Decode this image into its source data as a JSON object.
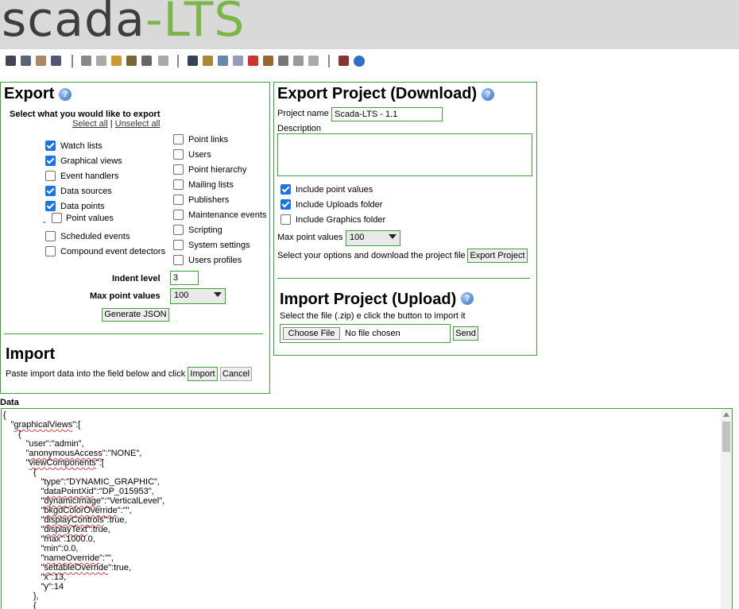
{
  "logo": {
    "part1": "scada",
    "sep": "-",
    "part2": "LTS"
  },
  "toolbar": {
    "icons": [
      "monitor-icon",
      "image-icon",
      "pencil-icon",
      "book-icon",
      "gear-icon",
      "database-icon",
      "clock-icon",
      "bug-icon",
      "hat-icon",
      "eraser-icon",
      "user-icon",
      "users-icon",
      "folders-icon",
      "documents-icon",
      "antenna-icon",
      "hammer-icon",
      "table-icon",
      "code-icon",
      "page-icon",
      "logout-icon",
      "help-icon"
    ]
  },
  "export": {
    "title": "Export",
    "select_label": "Select what you would like to export",
    "select_all": "Select all",
    "sep": " | ",
    "unselect_all": "Unselect all",
    "left_items": [
      {
        "label": "Watch lists",
        "checked": true
      },
      {
        "label": "Graphical views",
        "checked": true
      },
      {
        "label": "Event handlers",
        "checked": false
      },
      {
        "label": "Data sources",
        "checked": true
      },
      {
        "label": "Data points",
        "checked": true
      },
      {
        "label": "Point values",
        "checked": false,
        "prefix": "-"
      },
      {
        "label": "Scheduled events",
        "checked": false
      },
      {
        "label": "Compound event detectors",
        "checked": false
      }
    ],
    "right_items": [
      {
        "label": "Point links",
        "checked": false
      },
      {
        "label": "Users",
        "checked": false
      },
      {
        "label": "Point hierarchy",
        "checked": false
      },
      {
        "label": "Mailing lists",
        "checked": false
      },
      {
        "label": "Publishers",
        "checked": false
      },
      {
        "label": "Maintenance events",
        "checked": false
      },
      {
        "label": "Scripting",
        "checked": false
      },
      {
        "label": "System settings",
        "checked": false
      },
      {
        "label": "Users profiles",
        "checked": false
      }
    ],
    "indent_label": "Indent level",
    "indent_value": "3",
    "max_label": "Max point values",
    "max_value": "100",
    "generate_label": "Generate JSON"
  },
  "import": {
    "title": "Import",
    "desc": "Paste import data into the field below and click",
    "import_label": "Import",
    "cancel_label": "Cancel"
  },
  "project_export": {
    "title": "Export Project (Download)",
    "name_label": "Project name",
    "name_value": "Scada-LTS - 1.1",
    "desc_label": "Description",
    "options": [
      {
        "label": "Include point values",
        "checked": true
      },
      {
        "label": "Include Uploads folder",
        "checked": true
      },
      {
        "label": "Include Graphics folder",
        "checked": false
      }
    ],
    "max_label": "Max point values",
    "max_value": "100",
    "download_text": "Select your options and download the project file",
    "export_btn": "Export Project"
  },
  "project_import": {
    "title": "Import Project (Upload)",
    "desc": "Select the file (.zip) e click the button to import it",
    "choose_btn": "Choose File",
    "no_file": "No file chosen",
    "send_btn": "Send"
  },
  "data": {
    "label": "Data",
    "lines": [
      {
        "indent": 0,
        "pre": "{",
        "key": "",
        "post": ""
      },
      {
        "indent": 1,
        "pre": "\"",
        "key": "graphicalViews",
        "post": "\":["
      },
      {
        "indent": 2,
        "pre": "{",
        "key": "",
        "post": ""
      },
      {
        "indent": 3,
        "pre": "\"user\":\"admin\",",
        "key": "",
        "post": ""
      },
      {
        "indent": 3,
        "pre": "\"",
        "key": "anonymousAccess",
        "post": "\":\"NONE\","
      },
      {
        "indent": 3,
        "pre": "\"",
        "key": "viewComponents",
        "post": "\":["
      },
      {
        "indent": 4,
        "pre": "{",
        "key": "",
        "post": ""
      },
      {
        "indent": 5,
        "pre": "\"type\":\"DYNAMIC_GRAPHIC\",",
        "key": "",
        "post": ""
      },
      {
        "indent": 5,
        "pre": "\"",
        "key": "dataPointXid",
        "post": "\":\"DP_015953\","
      },
      {
        "indent": 5,
        "pre": "\"",
        "key": "dynamicImage",
        "post": "\":\"VerticalLevel\","
      },
      {
        "indent": 5,
        "pre": "\"",
        "key": "bkgdColorOverride",
        "post": "\":\"\","
      },
      {
        "indent": 5,
        "pre": "\"",
        "key": "displayControls",
        "post": "\":true,"
      },
      {
        "indent": 5,
        "pre": "\"",
        "key": "displayText",
        "post": "\":true,"
      },
      {
        "indent": 5,
        "pre": "\"max\":1000.0,",
        "key": "",
        "post": ""
      },
      {
        "indent": 5,
        "pre": "\"min\":0.0,",
        "key": "",
        "post": ""
      },
      {
        "indent": 5,
        "pre": "\"",
        "key": "nameOverride",
        "post": "\":\"\","
      },
      {
        "indent": 5,
        "pre": "\"",
        "key": "settableOverride",
        "post": "\":true,"
      },
      {
        "indent": 5,
        "pre": "\"x\":13,",
        "key": "",
        "post": ""
      },
      {
        "indent": 5,
        "pre": "\"y\":14",
        "key": "",
        "post": ""
      },
      {
        "indent": 4,
        "pre": "},",
        "key": "",
        "post": ""
      },
      {
        "indent": 4,
        "pre": "{",
        "key": "",
        "post": ""
      }
    ]
  }
}
